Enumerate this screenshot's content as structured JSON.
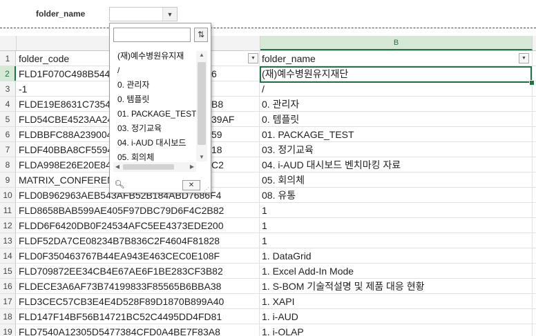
{
  "filter": {
    "label": "folder_name",
    "selected_value": "",
    "arrow_icon": "triangle-down-icon"
  },
  "columns": {
    "a_header": "",
    "b_header": "B"
  },
  "header_row": {
    "num": "1",
    "a": "folder_code",
    "b": "folder_name"
  },
  "rows": [
    {
      "num": "2",
      "a": "FLD1F070C498B544",
      "a_tail": "6",
      "b": "(재)예수병원유지재단"
    },
    {
      "num": "3",
      "a": "-1",
      "a_tail": "",
      "b": "/"
    },
    {
      "num": "4",
      "a": "FLDE19E8631C7354",
      "a_tail": "B8",
      "b": "0. 관리자"
    },
    {
      "num": "5",
      "a": "FLD54CBE4523AA24",
      "a_tail": "39AF",
      "b": "0. 템플릿"
    },
    {
      "num": "6",
      "a": "FLDBBFC88A239004",
      "a_tail": "59",
      "b": "01. PACKAGE_TEST"
    },
    {
      "num": "7",
      "a": "FLDF40BBA8CF5594",
      "a_tail": "18",
      "b": "03. 정기교육"
    },
    {
      "num": "8",
      "a": "FLDA998E26E20E84",
      "a_tail": "C2",
      "b": "04. i-AUD 대시보드 벤치마킹 자료"
    },
    {
      "num": "9",
      "a": "MATRIX_CONFEREN",
      "a_tail": "",
      "b": "05. 회의체"
    },
    {
      "num": "10",
      "a": "FLD0B962963AEB543AFB52B184ABD7686F4",
      "a_tail": "",
      "b": "08. 유통"
    },
    {
      "num": "11",
      "a": "FLD8658BAB599AE405F97DBC79D6F4C2B82",
      "a_tail": "",
      "b": "1"
    },
    {
      "num": "12",
      "a": "FLDD6F6420DB0F24534AFC5EE4373EDE200",
      "a_tail": "",
      "b": "1"
    },
    {
      "num": "13",
      "a": "FLDF52DA7CE08234B7B836C2F4604F81828",
      "a_tail": "",
      "b": "1"
    },
    {
      "num": "14",
      "a": "FLD0F350463767B44EA943E463CEC0E108F",
      "a_tail": "",
      "b": "1. DataGrid"
    },
    {
      "num": "15",
      "a": "FLD709872EE34CB4E67AE6F1BE283CF3B82",
      "a_tail": "",
      "b": "1. Excel Add-In Mode"
    },
    {
      "num": "16",
      "a": "FLDECE3A6AF73B74199833F85565B6BBA38",
      "a_tail": "",
      "b": "1. S-BOM 기술적설명 및 제품 대응 현황"
    },
    {
      "num": "17",
      "a": "FLD3CEC57CB3E4E4D528F89D1870B899A40",
      "a_tail": "",
      "b": "1. XAPI"
    },
    {
      "num": "18",
      "a": "FLD147F14BF56B14721BC52C4495DD4FD81",
      "a_tail": "",
      "b": "1. i-AUD"
    },
    {
      "num": "19",
      "a": "FLD7540A12305D5477384CFD0A4BE7F83A8",
      "a_tail": "",
      "b": "1. i-OLAP"
    }
  ],
  "popup": {
    "search_value": "",
    "sort_icon": "sort-icon",
    "items": [
      "(재)예수병원유지재",
      "/",
      "0. 관리자",
      "0. 템플릿",
      "01. PACKAGE_TEST",
      "03. 정기교육",
      "04. i-AUD 대시보드",
      "05. 회의체"
    ],
    "zoom_icon": "magnifier-icon",
    "clear_icon": "close-icon"
  }
}
